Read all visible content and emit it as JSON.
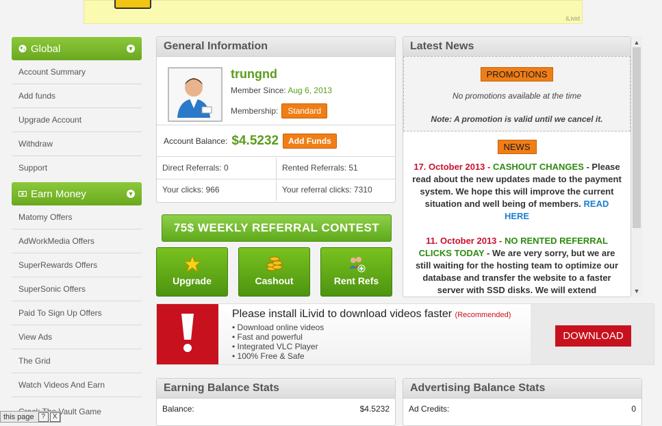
{
  "top_ad": {
    "brand": "iLivid"
  },
  "sidebar": {
    "global": {
      "label": "Global",
      "items": [
        "Account Summary",
        "Add funds",
        "Upgrade Account",
        "Withdraw",
        "Support"
      ]
    },
    "earn": {
      "label": "Earn Money",
      "items": [
        "Matomy Offers",
        "AdWorkMedia Offers",
        "SuperRewards Offers",
        "SuperSonic Offers",
        "Paid To Sign Up Offers",
        "View Ads",
        "The Grid",
        "Watch Videos And Earn"
      ]
    },
    "partial_item": "Crack The Vault Game"
  },
  "general_info": {
    "title": "General Information",
    "username": "trungnd",
    "member_since_label": "Member Since:",
    "member_since_value": "Aug 6, 2013",
    "membership_label": "Membership:",
    "membership_value": "Standard",
    "balance_label": "Account Balance:",
    "balance_value": "$4.5232",
    "add_funds": "Add Funds",
    "direct_referrals": "Direct Referrals: 0",
    "rented_referrals": "Rented Referrals: 51",
    "your_clicks": "Your clicks: 966",
    "referral_clicks": "Your referral clicks: 7310"
  },
  "contest": {
    "label": "75$ WEEKLY REFERRAL CONTEST"
  },
  "actions": {
    "upgrade": "Upgrade",
    "cashout": "Cashout",
    "rent_refs": "Rent Refs"
  },
  "news": {
    "title": "Latest News",
    "promotions_tag": "PROMOTIONS",
    "no_promotions": "No promotions available at the time",
    "promo_note": "Note: A promotion is valid until we cancel it.",
    "news_tag": "NEWS",
    "item1": {
      "date": "17. October 2013",
      "sep": " - ",
      "title": "CASHOUT CHANGES",
      "body": " - Please read about the new updates made to the payment system. We hope this will improve the current situation and well being of members. ",
      "link": "READ HERE"
    },
    "item2": {
      "date": "11. October 2013",
      "sep": " - ",
      "title": "NO RENTED REFERRAL CLICKS TODAY",
      "body": " - We are very sorry, but we are still waiting for the hosting team to optimize our database and transfer the website to a faster server with SSD disks. We will extend"
    }
  },
  "banner": {
    "title": "Please install iLivid to download videos faster",
    "recommended": "(Recommended)",
    "bullets": [
      "• Download online videos",
      "• Fast and powerful",
      "• Integrated VLC Player",
      "• 100% Free & Safe"
    ],
    "download": "DOWNLOAD"
  },
  "earning_stats": {
    "title": "Earning Balance Stats",
    "label": "Balance:",
    "value": "$4.5232"
  },
  "advertising_stats": {
    "title": "Advertising Balance Stats",
    "label": "Ad Credits:",
    "value": "0"
  },
  "status_bar": {
    "text": "this page",
    "help": "?",
    "close": "X"
  }
}
